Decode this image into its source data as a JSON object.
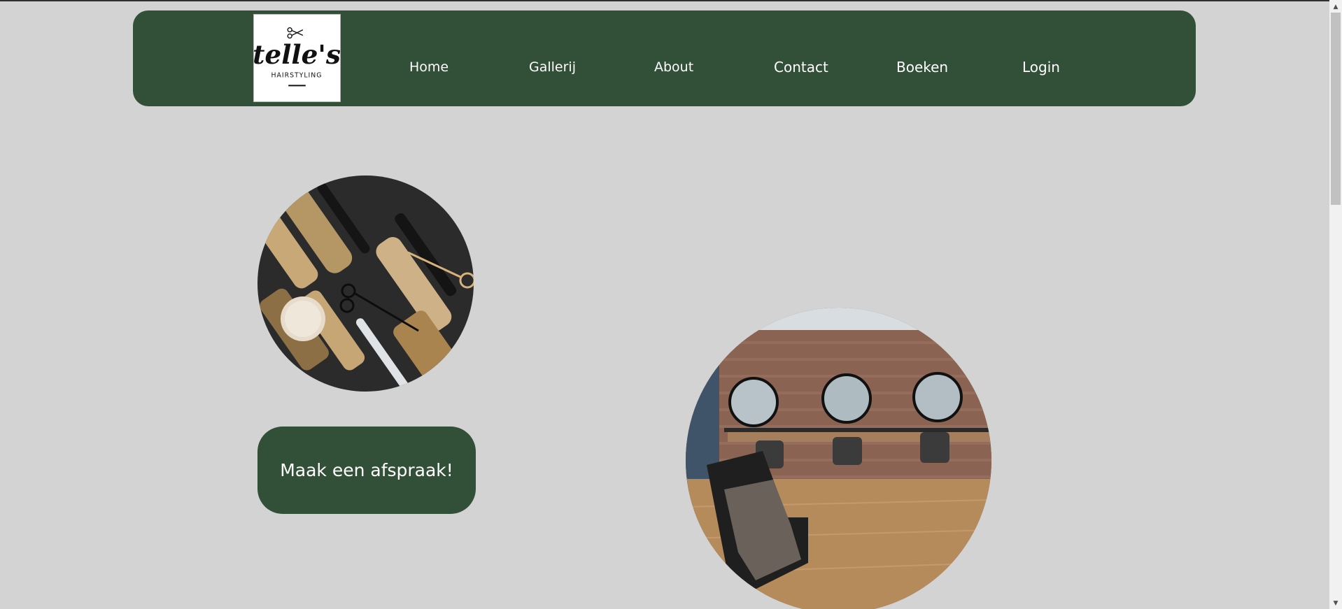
{
  "logo": {
    "name": "telle's",
    "tagline": "HAIRSTYLING",
    "icon": "scissors-icon"
  },
  "nav": {
    "items": [
      {
        "label": "Home"
      },
      {
        "label": "Gallerij"
      },
      {
        "label": "About"
      },
      {
        "label": "Contact"
      },
      {
        "label": "Boeken"
      },
      {
        "label": "Login"
      }
    ]
  },
  "hero": {
    "cta_label": "Maak een afspraak!"
  },
  "colors": {
    "brand_green": "#324f38",
    "page_background": "#d3d3d3",
    "text_on_brand": "#ffffff"
  },
  "scrollbar": {
    "up_icon": "scroll-up-arrow-icon",
    "down_icon": "scroll-down-arrow-icon"
  }
}
